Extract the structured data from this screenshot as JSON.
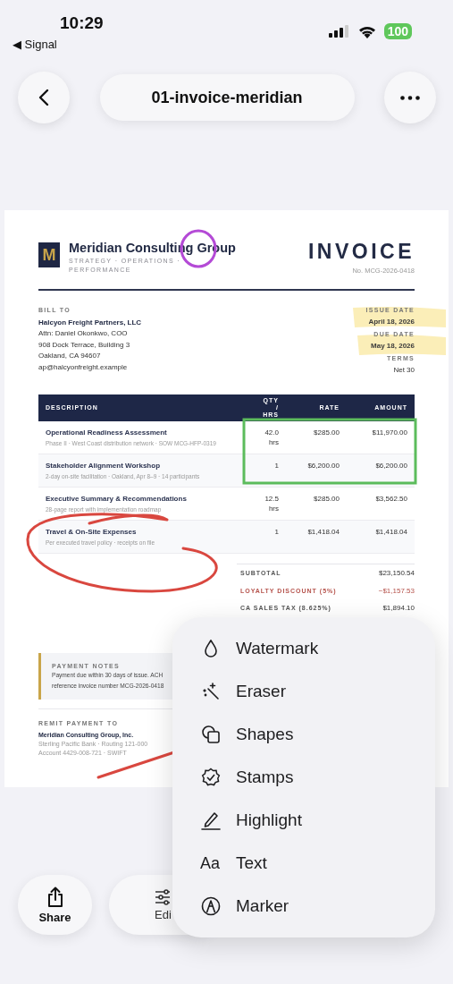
{
  "status_bar": {
    "time": "10:29",
    "back_app": "◀ Signal",
    "battery": "100"
  },
  "nav": {
    "title": "01-invoice-meridian"
  },
  "document": {
    "logo_letter": "M",
    "company": "Meridian Consulting Group",
    "tagline": "STRATEGY · OPERATIONS · PERFORMANCE",
    "doc_title": "INVOICE",
    "number": "No. MCG-2026-0418",
    "bill_to": {
      "label": "BILL TO",
      "name": "Halcyon Freight Partners, LLC",
      "lines": [
        "Attn: Daniel Okonkwo, COO",
        "908 Dock Terrace, Building 3",
        "Oakland, CA 94607",
        "ap@halcyonfreight.example"
      ]
    },
    "meta": [
      {
        "label": "ISSUE DATE",
        "value": "April 18, 2026",
        "highlighted": true
      },
      {
        "label": "DUE DATE",
        "value": "May 18, 2026",
        "highlighted": true
      },
      {
        "label": "TERMS",
        "value": "Net 30",
        "highlighted": false
      }
    ],
    "table": {
      "columns": [
        "DESCRIPTION",
        "QTY / HRS",
        "RATE",
        "AMOUNT"
      ],
      "rows": [
        {
          "title": "Operational Readiness Assessment",
          "detail": "Phase II · West Coast distribution network · SOW MCG-HFP-0319",
          "qty": "42.0 hrs",
          "rate": "$285.00",
          "amount": "$11,970.00"
        },
        {
          "title": "Stakeholder Alignment Workshop",
          "detail": "2-day on-site facilitation · Oakland, Apr 8–9 · 14 participants",
          "qty": "1",
          "rate": "$6,200.00",
          "amount": "$6,200.00"
        },
        {
          "title": "Executive Summary & Recommendations",
          "detail": "28-page report with implementation roadmap",
          "qty": "12.5 hrs",
          "rate": "$285.00",
          "amount": "$3,562.50"
        },
        {
          "title": "Travel & On-Site Expenses",
          "detail": "Per executed travel policy · receipts on file",
          "qty": "1",
          "rate": "$1,418.04",
          "amount": "$1,418.04"
        }
      ]
    },
    "totals": [
      {
        "label": "SUBTOTAL",
        "value": "$23,150.54",
        "kind": "plain"
      },
      {
        "label": "LOYALTY DISCOUNT (5%)",
        "value": "−$1,157.53",
        "kind": "discount"
      },
      {
        "label": "CA SALES TAX (8.625%)",
        "value": "$1,894.10",
        "kind": "plain"
      }
    ],
    "payment_notes": {
      "label": "PAYMENT NOTES",
      "lines": [
        "Payment due within 30 days of issue. ACH",
        "reference invoice number MCG-2026-0418"
      ]
    },
    "remit": {
      "label": "REMIT PAYMENT TO",
      "name": "Meridian Consulting Group, Inc.",
      "lines": [
        "Sterling Pacific Bank · Routing 121-000",
        "Account 4429-008-721 · SWIFT"
      ]
    }
  },
  "menu": [
    {
      "label": "Watermark",
      "kind": "drop"
    },
    {
      "label": "Eraser",
      "kind": "wand"
    },
    {
      "label": "Shapes",
      "kind": "shapes"
    },
    {
      "label": "Stamps",
      "kind": "badge"
    },
    {
      "label": "Highlight",
      "kind": "pen"
    },
    {
      "label": "Text",
      "kind": "text",
      "glyph": "Aa"
    },
    {
      "label": "Marker",
      "kind": "marker"
    }
  ],
  "toolbar": [
    {
      "label": "Share",
      "kind": "share"
    },
    {
      "label": "Edi",
      "kind": "sliders"
    }
  ]
}
